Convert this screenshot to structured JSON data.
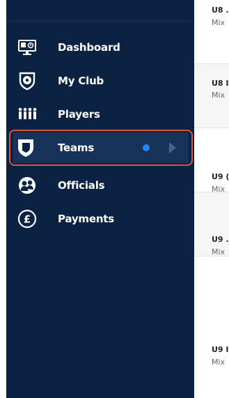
{
  "sidebar": {
    "items": [
      {
        "label": "Dashboard",
        "icon": "dashboard-screen-icon"
      },
      {
        "label": "My Club",
        "icon": "club-badge-icon"
      },
      {
        "label": "Players",
        "icon": "players-group-icon"
      },
      {
        "label": "Teams",
        "icon": "teams-shield-icon",
        "active": true,
        "status_dot_color": "#1e88f5"
      },
      {
        "label": "Officials",
        "icon": "officials-icon"
      },
      {
        "label": "Payments",
        "icon": "pound-payments-icon"
      }
    ],
    "active_highlight_color": "#d9573f",
    "background_color": "#0b2242"
  },
  "teams_list": {
    "rows": [
      {
        "title": "U8 .",
        "subtitle": "Mix"
      },
      {
        "title": "U8 I",
        "subtitle": "Mix"
      },
      {
        "title": "U9 (",
        "subtitle": "Mix"
      },
      {
        "title": "U9 .",
        "subtitle": "Mix"
      },
      {
        "title": "U9 I",
        "subtitle": "Mix"
      }
    ]
  }
}
